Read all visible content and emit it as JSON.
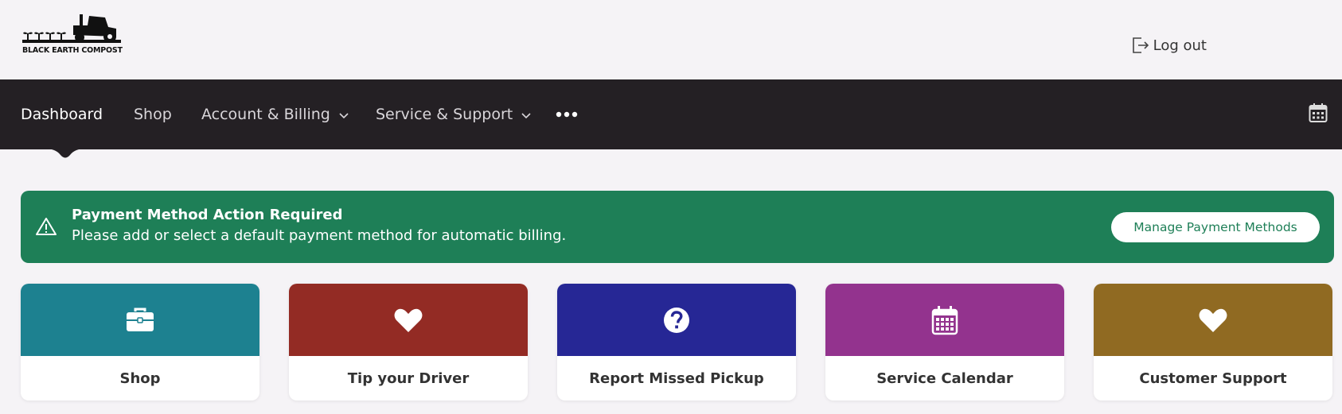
{
  "header": {
    "logo_text": "BLACK EARTH COMPOST",
    "logout_label": "Log out"
  },
  "nav": {
    "items": [
      {
        "label": "Dashboard",
        "active": true
      },
      {
        "label": "Shop"
      },
      {
        "label": "Account & Billing",
        "has_dropdown": true
      },
      {
        "label": "Service & Support",
        "has_dropdown": true
      }
    ],
    "more_icon": "ellipsis-icon",
    "calendar_icon": "calendar-icon"
  },
  "alert": {
    "title": "Payment Method Action Required",
    "message": "Please add or select a default payment method for automatic billing.",
    "button_label": "Manage Payment Methods",
    "icon": "warning-triangle-icon",
    "color": "#1e7f57"
  },
  "tiles": [
    {
      "label": "Shop",
      "icon": "briefcase-icon",
      "color": "#1d8190"
    },
    {
      "label": "Tip your Driver",
      "icon": "heart-icon",
      "color": "#932b24"
    },
    {
      "label": "Report Missed Pickup",
      "icon": "question-circle-icon",
      "color": "#262795"
    },
    {
      "label": "Service Calendar",
      "icon": "calendar-icon",
      "color": "#93338e"
    },
    {
      "label": "Customer Support",
      "icon": "heart-icon",
      "color": "#906a22"
    }
  ]
}
